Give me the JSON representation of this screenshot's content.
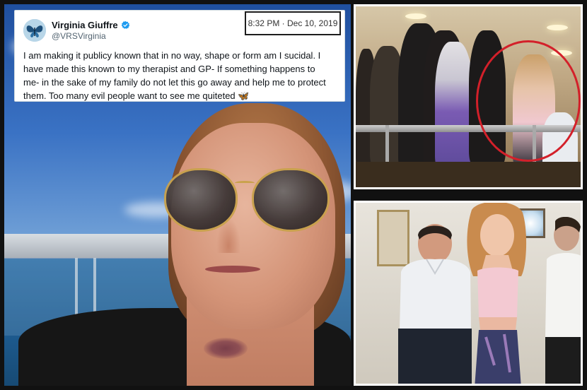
{
  "tweet": {
    "display_name": "Virginia Giuffre",
    "handle": "@VRSVirginia",
    "text": "I am making it publicy known that in no way, shape or form am I sucidal. I have made this known to my therapist and GP- If something happens to me- in the sake of my family do not let this go away and help me to protect them. Too many evil people want to see me quiteted",
    "emoji": "🦋",
    "avatar_icon": "butterfly-icon",
    "verified_icon": "verified-badge-icon",
    "verified_color": "#1d9bf0"
  },
  "timestamp": "8:32 PM · Dec 10, 2019",
  "colors": {
    "highlight_circle": "#d3202a",
    "frame_border": "#ffffff",
    "background": "#111111"
  }
}
